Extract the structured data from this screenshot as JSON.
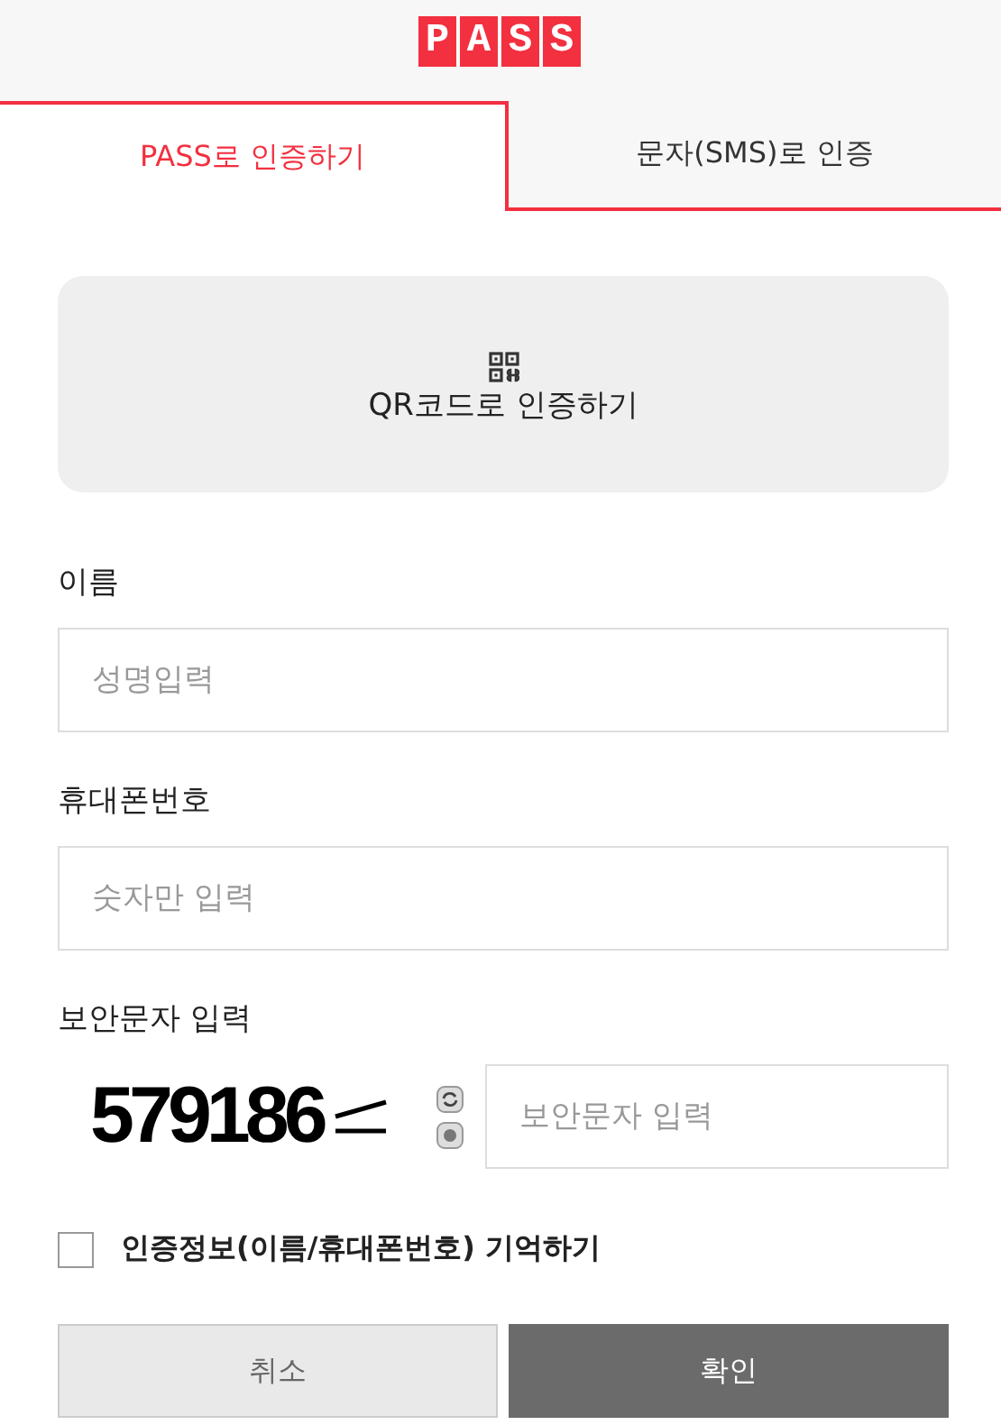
{
  "logo": "PASS",
  "tabs": [
    {
      "label": "PASS로 인증하기",
      "selected": true
    },
    {
      "label": "문자(SMS)로 인증",
      "selected": false
    }
  ],
  "qr_button": {
    "label": "QR코드로 인증하기"
  },
  "fields": [
    {
      "label": "이름",
      "placeholder": "성명입력"
    },
    {
      "label": "휴대폰번호",
      "placeholder": "숫자만 입력"
    }
  ],
  "captcha": {
    "label": "보안문자 입력",
    "code": "579186",
    "placeholder": "보안문자 입력"
  },
  "remember": {
    "label": "인증정보(이름/휴대폰번호) 기억하기",
    "checked": false
  },
  "buttons": [
    {
      "label": "취소",
      "kind": "cancel"
    },
    {
      "label": "확인",
      "kind": "confirm"
    }
  ]
}
